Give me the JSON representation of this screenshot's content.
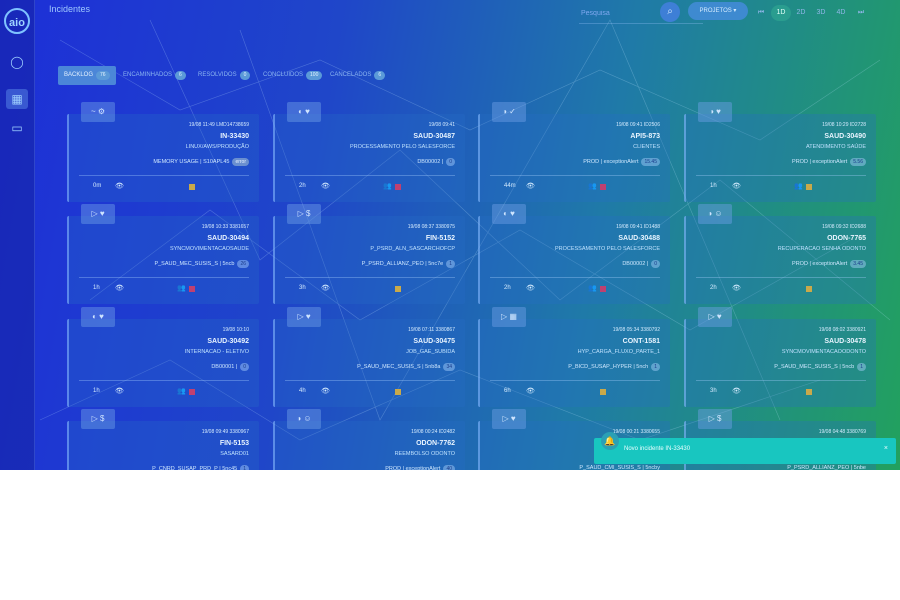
{
  "app": {
    "logo": "aio"
  },
  "sidebar": {
    "items": [
      {
        "icon": "user-circle-icon"
      },
      {
        "icon": "grid-icon"
      },
      {
        "icon": "window-icon"
      }
    ]
  },
  "header": {
    "title": "Incidentes",
    "search_placeholder": "Pesquisa",
    "projects_label": "PROJETOS ▾",
    "periods": [
      "1D",
      "2D",
      "3D",
      "4D"
    ],
    "active_period": "1D"
  },
  "tabs": [
    {
      "label": "BACKLOG",
      "count": "76",
      "active": true
    },
    {
      "label": "ENCAMINHADOS",
      "count": "6"
    },
    {
      "label": "RESOLVIDOS",
      "count": "0"
    },
    {
      "label": "CONCLUIDOS",
      "count": "100"
    },
    {
      "label": "CANCELADOS",
      "count": "6"
    }
  ],
  "cards": [
    {
      "ts": "19/08 11:49 LMD14738659",
      "code": "IN-33430",
      "desc": "LINUX/AWS/PRODUÇÃO",
      "ctx": "MEMORY USAGE | S10APL45",
      "badge": "error",
      "badge_err": true,
      "time": "0m",
      "icons": "~ ⚙",
      "flag_color": "#c9a94a"
    },
    {
      "ts": "19/08 09:41",
      "code": "SAUD-30487",
      "desc": "PROCESSAMENTO PELO SALESFORCE",
      "ctx": "DB00002 |",
      "badge": "0",
      "time": "2h",
      "icons": "◐ ♥",
      "flag_color": "#c04070",
      "user": "true"
    },
    {
      "ts": "19/08 09:41 ID2506",
      "code": "API5-873",
      "desc": "CLIENTES",
      "ctx": "PROD | exceptionAlert",
      "badge": "15.45",
      "time": "44m",
      "icons": "◑ ✓",
      "flag_color": "#c04070",
      "user": "true"
    },
    {
      "ts": "19/08 10:29 ID2728",
      "code": "SAUD-30490",
      "desc": "ATENDIMENTO SAÚDE",
      "ctx": "PROD | exceptionAlert",
      "badge": "5.56",
      "time": "1h",
      "icons": "◑ ♥",
      "flag_color": "#c9a94a",
      "user": "true"
    },
    {
      "ts": "19/08 10:33 3381657",
      "code": "SAUD-30494",
      "desc": "SYNCMOVIMENTACAOSAUDE",
      "ctx": "P_SAUD_MEC_SUSIS_S | 5ncb",
      "badge": "26",
      "time": "1h",
      "icons": "▷ ♥",
      "flag_color": "#c04070",
      "user": "true"
    },
    {
      "ts": "19/08 08:37 3380975",
      "code": "FIN-5152",
      "desc": "P_PSRD_ALN_SASCARCHOFCP",
      "ctx": "P_PSRD_ALLIANZ_PEO | 5nc7e",
      "badge": "1",
      "time": "3h",
      "icons": "▷ $",
      "flag_color": "#c9a94a"
    },
    {
      "ts": "19/08 09:41 ID1488",
      "code": "SAUD-30488",
      "desc": "PROCESSAMENTO PELO SALESFORCE",
      "ctx": "DB00002 |",
      "badge": "0",
      "time": "2h",
      "icons": "◐ ♥",
      "flag_color": "#c04070",
      "user": "true"
    },
    {
      "ts": "19/08 09:32 ID2688",
      "code": "ODON-7765",
      "desc": "RECUPERACAO SENHA ODONTO",
      "ctx": "PROD | exceptionAlert",
      "badge": "3.45",
      "time": "2h",
      "icons": "◑ ☺",
      "flag_color": "#c9a94a"
    },
    {
      "ts": "19/08 10:10",
      "code": "SAUD-30492",
      "desc": "INTERNACAO - ELETIVO",
      "ctx": "DB00001 |",
      "badge": "0",
      "time": "1h",
      "icons": "◐ ♥",
      "flag_color": "#c04070",
      "user": "true"
    },
    {
      "ts": "19/08 07:11 3380867",
      "code": "SAUD-30475",
      "desc": "JOB_GAE_SUBIDA",
      "ctx": "P_SAUD_MEC_SUSIS_S | 5nb8a",
      "badge": "34",
      "time": "4h",
      "icons": "▷ ♥",
      "flag_color": "#c9a94a"
    },
    {
      "ts": "19/08 05:34 3380792",
      "code": "CONT-1581",
      "desc": "HYP_CARGA_FLUXO_PARTE_1",
      "ctx": "P_BICD_SUSAP_HYPER | 5nch",
      "badge": "1",
      "time": "6h",
      "icons": "▷ ▦",
      "flag_color": "#c9a94a"
    },
    {
      "ts": "19/08 08:02 3380921",
      "code": "SAUD-30478",
      "desc": "SYNCMOVIMENTACAOODONTO",
      "ctx": "P_SAUD_MEC_SUSIS_S | 5ncb",
      "badge": "1",
      "time": "3h",
      "icons": "▷ ♥",
      "flag_color": "#c9a94a"
    },
    {
      "ts": "19/08 09:49 3380967",
      "code": "FIN-5153",
      "desc": "SASARD01",
      "ctx": "P_CNRD_SUSAP_PRD_P | 5nc45",
      "badge": "1",
      "time": "",
      "icons": "▷ $",
      "flag_color": "#c9a94a"
    },
    {
      "ts": "19/08 00:24 ID2482",
      "code": "ODON-7762",
      "desc": "REEMBOLSO ODONTO",
      "ctx": "PROD | exceptionAlert",
      "badge": "40",
      "time": "",
      "icons": "◑ ☺",
      "flag_color": "#c9a94a"
    },
    {
      "ts": "19/08 00:21 3380655",
      "code": "",
      "desc": "",
      "ctx": "P_SAUD_CMI_SUSIS_S | 5ncby",
      "badge": "",
      "time": "",
      "icons": "▷ ♥",
      "flag_color": "#c9a94a"
    },
    {
      "ts": "19/08 04:48 3380769",
      "code": "",
      "desc": "",
      "ctx": "P_PSRD_ALLIANZ_PEO | 5nbe",
      "badge": "",
      "time": "",
      "icons": "▷ $",
      "flag_color": "#c9a94a"
    }
  ],
  "toast": {
    "text": "Novo incidente IN-33430",
    "close": "×"
  }
}
